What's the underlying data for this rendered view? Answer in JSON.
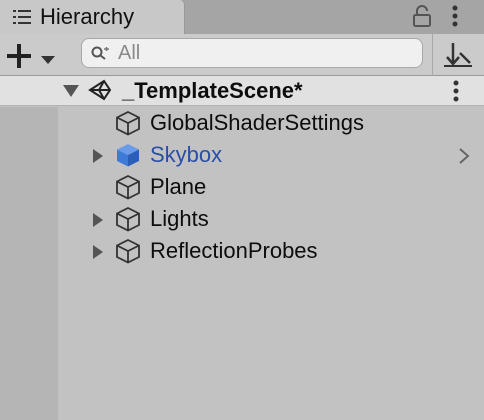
{
  "panel": {
    "tab_title": "Hierarchy",
    "tab_icon": "list-icon",
    "lock_icon": "lock-icon",
    "menu_icon": "kebab-menu-icon"
  },
  "toolbar": {
    "add_icon": "plus-icon",
    "dropdown_icon": "chevron-down-icon",
    "search_placeholder": "All",
    "search_value": "",
    "sort_icon": "sort-icon"
  },
  "scene": {
    "name": "_TemplateScene*",
    "icon": "unity-scene-icon",
    "expanded": true
  },
  "tree": [
    {
      "label": "GlobalShaderSettings",
      "has_children": false,
      "selected": false,
      "icon": "gameobject-cube-icon"
    },
    {
      "label": "Skybox",
      "has_children": true,
      "selected": true,
      "icon": "prefab-cube-icon"
    },
    {
      "label": "Plane",
      "has_children": false,
      "selected": false,
      "icon": "gameobject-cube-icon"
    },
    {
      "label": "Lights",
      "has_children": true,
      "selected": false,
      "icon": "gameobject-cube-icon"
    },
    {
      "label": "ReflectionProbes",
      "has_children": true,
      "selected": false,
      "icon": "gameobject-cube-icon"
    }
  ],
  "colors": {
    "panel_bg": "#c2c2c2",
    "scene_header_bg": "#e1e1e1",
    "selected_text": "#2a4ea8",
    "prefab_icon": "#3f7ad9"
  }
}
